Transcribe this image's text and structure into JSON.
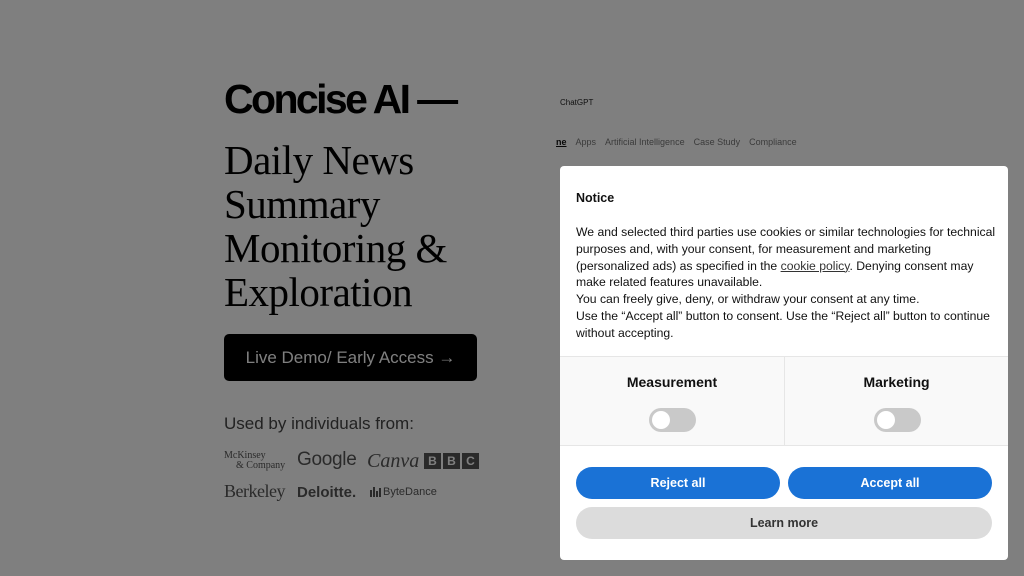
{
  "hero": {
    "brand": "Concise AI —",
    "tagline_lines": [
      "Daily News",
      "Summary",
      "Monitoring &",
      "Exploration"
    ],
    "cta_label": "Live Demo/ Early Access →",
    "used_by_label": "Used by individuals from:"
  },
  "logos": {
    "mckinsey_line1": "McKinsey",
    "mckinsey_line2": "& Company",
    "google": "Google",
    "canva": "Canva",
    "bbc": [
      "B",
      "B",
      "C"
    ],
    "berkeley": "Berkeley",
    "deloitte": "Deloitte.",
    "bytedance": "ByteDance"
  },
  "preview": {
    "search_value": "ChatGPT",
    "tabs": [
      "ne",
      "Apps",
      "Artificial Intelligence",
      "Case Study",
      "Compliance"
    ]
  },
  "consent_dialog": {
    "title": "Notice",
    "body_before_link": "We and selected third parties use cookies or similar technologies for technical purposes and, with your consent, for measurement and marketing (personalized ads) as specified in the ",
    "link_text": "cookie policy",
    "body_after_link": ". Denying consent may make related features unavailable.",
    "line2": "You can freely give, deny, or withdraw your consent at any time.",
    "line3": "Use the “Accept all” button to consent. Use the “Reject all” button to continue without accepting.",
    "preferences": [
      {
        "label": "Measurement",
        "enabled": false
      },
      {
        "label": "Marketing",
        "enabled": false
      }
    ],
    "reject_label": "Reject all",
    "accept_label": "Accept all",
    "learn_more_label": "Learn more",
    "accent_color": "#1a72d6"
  }
}
